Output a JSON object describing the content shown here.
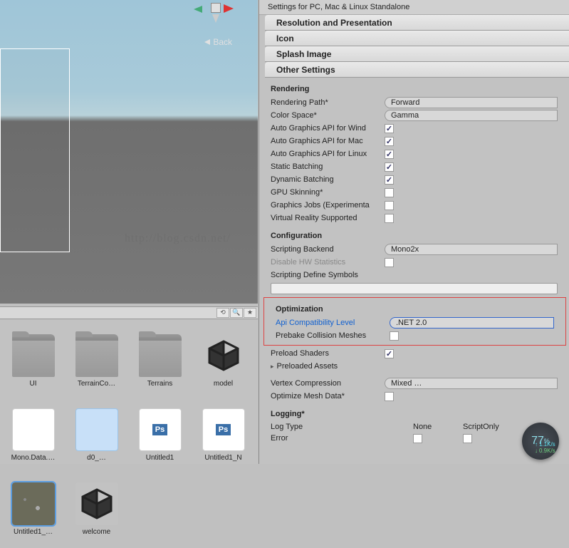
{
  "scene": {
    "back_label": "Back",
    "watermark": "http://blog.csdn.net/"
  },
  "assets": {
    "items": [
      {
        "label": "UI",
        "type": "folder"
      },
      {
        "label": "TerrainCo…",
        "type": "folder"
      },
      {
        "label": "Terrains",
        "type": "folder"
      },
      {
        "label": "model",
        "type": "unity"
      },
      {
        "label": "Mono.Data.…",
        "type": "white"
      },
      {
        "label": "d0_…",
        "type": "blue"
      },
      {
        "label": "Untitled1",
        "type": "ps"
      },
      {
        "label": "Untitled1_N",
        "type": "ps"
      },
      {
        "label": "Untitled1_…",
        "type": "aerial",
        "selected": true
      },
      {
        "label": "welcome",
        "type": "unity"
      }
    ]
  },
  "inspector": {
    "title": "Settings for PC, Mac & Linux Standalone",
    "sections": {
      "resolution": "Resolution and Presentation",
      "icon": "Icon",
      "splash": "Splash Image",
      "other": "Other Settings"
    },
    "rendering": {
      "header": "Rendering",
      "rendering_path": {
        "label": "Rendering Path*",
        "value": "Forward"
      },
      "color_space": {
        "label": "Color Space*",
        "value": "Gamma"
      },
      "auto_gfx_win": {
        "label": "Auto Graphics API for Wind",
        "checked": true
      },
      "auto_gfx_mac": {
        "label": "Auto Graphics API for Mac",
        "checked": true
      },
      "auto_gfx_linux": {
        "label": "Auto Graphics API for Linux",
        "checked": true
      },
      "static_batch": {
        "label": "Static Batching",
        "checked": true
      },
      "dynamic_batch": {
        "label": "Dynamic Batching",
        "checked": true
      },
      "gpu_skinning": {
        "label": "GPU Skinning*",
        "checked": false
      },
      "gfx_jobs": {
        "label": "Graphics Jobs (Experimenta",
        "checked": false
      },
      "vr_supported": {
        "label": "Virtual Reality Supported",
        "checked": false
      }
    },
    "configuration": {
      "header": "Configuration",
      "scripting_backend": {
        "label": "Scripting Backend",
        "value": "Mono2x"
      },
      "disable_hw": {
        "label": "Disable HW Statistics",
        "checked": false
      },
      "define_symbols": {
        "label": "Scripting Define Symbols"
      }
    },
    "optimization": {
      "header": "Optimization",
      "api_compat": {
        "label": "Api Compatibility Level",
        "value": ".NET 2.0"
      },
      "prebake": {
        "label": "Prebake Collision Meshes",
        "checked": false
      },
      "preload_shaders": {
        "label": "Preload Shaders",
        "checked": true
      },
      "preloaded_assets": {
        "label": "Preloaded Assets"
      },
      "vertex_compression": {
        "label": "Vertex Compression",
        "value": "Mixed …"
      },
      "optimize_mesh": {
        "label": "Optimize Mesh Data*",
        "checked": false
      }
    },
    "logging": {
      "header": "Logging*",
      "col_logtype": "Log Type",
      "col_none": "None",
      "col_scriptonly": "ScriptOnly",
      "row_error": "Error"
    }
  },
  "net_widget": {
    "percent": "77",
    "pct_sym": "%",
    "up": "1.1K/s",
    "down": "0.9K/s"
  }
}
